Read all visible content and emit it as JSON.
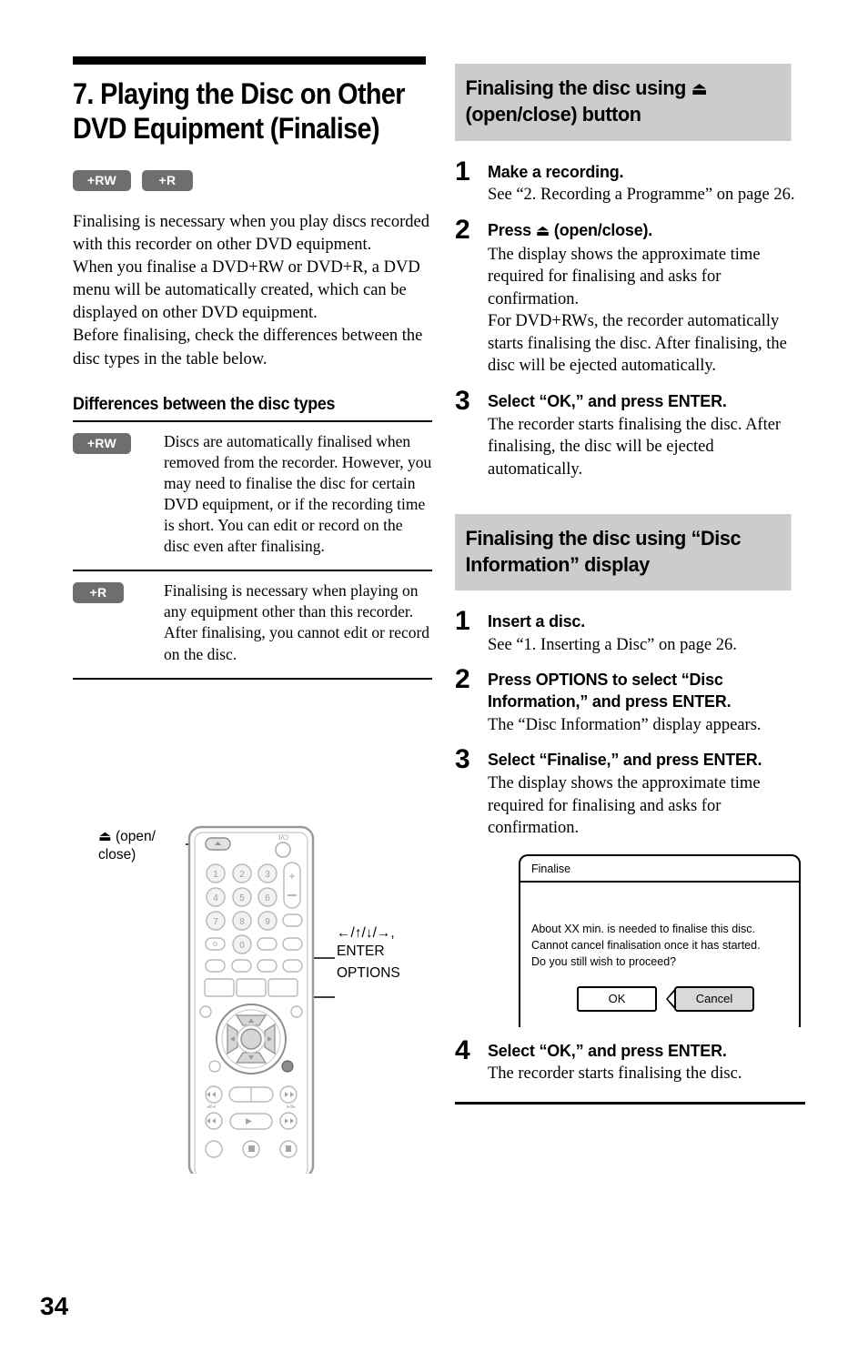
{
  "page": {
    "number": "34"
  },
  "chapter": {
    "title": "7. Playing the Disc on Other DVD Equipment (Finalise)",
    "badges": [
      {
        "label": "+RW"
      },
      {
        "label": "+R"
      }
    ],
    "intro": [
      "Finalising is necessary when you play discs recorded with this recorder on other DVD equipment.",
      "When you finalise a DVD+RW or DVD+R, a DVD menu will be automatically created, which can be displayed on other DVD equipment.",
      "Before finalising, check the differences between the disc types in the table below."
    ]
  },
  "disc_table": {
    "heading": "Differences between the disc types",
    "rows": [
      {
        "badge": "+RW",
        "description": "Discs are automatically finalised when removed from the recorder. However, you may need to finalise the disc for certain DVD equipment, or if the recording time is short. You can edit or record on the disc even after finalising."
      },
      {
        "badge": "+R",
        "description": "Finalising is necessary when playing on any equipment other than this recorder. After finalising, you cannot edit or record on the disc."
      }
    ]
  },
  "remote": {
    "callouts": [
      {
        "id": "eject",
        "line1": "⏏ (open/",
        "line2": "close)"
      },
      {
        "id": "dpad",
        "line1": "←/↑/↓/→,",
        "line2": "ENTER"
      },
      {
        "id": "options",
        "line1": "OPTIONS"
      }
    ],
    "keypad_digits": [
      "1",
      "2",
      "3",
      "4",
      "5",
      "6",
      "7",
      "8",
      "9",
      "0"
    ],
    "volume_plus": "+",
    "volume_minus": "−",
    "power_label": "I/⏻"
  },
  "sections": [
    {
      "heading_pre": "Finalising the disc using ",
      "heading_icon": "⏏",
      "heading_post": " (open/close) button",
      "steps": [
        {
          "num": "1",
          "title": "Make a recording.",
          "desc": "See “2. Recording a Programme” on page 26."
        },
        {
          "num": "2",
          "title_pre": "Press ",
          "title_icon": "⏏",
          "title_post": " (open/close).",
          "title": "Press ⏏ (open/close).",
          "desc": "The display shows the approximate time required for finalising and asks for confirmation.\nFor DVD+RWs, the recorder automatically starts finalising the disc. After finalising, the disc will be ejected automatically."
        },
        {
          "num": "3",
          "title": "Select “OK,” and press ENTER.",
          "desc": "The recorder starts finalising the disc. After finalising, the disc will be ejected automatically."
        }
      ]
    },
    {
      "heading": "Finalising the disc using “Disc Information” display",
      "steps": [
        {
          "num": "1",
          "title": "Insert a disc.",
          "desc": "See “1. Inserting a Disc” on page 26."
        },
        {
          "num": "2",
          "title": "Press OPTIONS to select “Disc Information,” and press ENTER.",
          "desc": "The “Disc Information” display appears."
        },
        {
          "num": "3",
          "title": "Select “Finalise,” and press ENTER.",
          "desc": "The display shows the approximate time required for finalising and asks for confirmation."
        },
        {
          "num": "4",
          "title": "Select “OK,” and press ENTER.",
          "desc": "The recorder starts finalising the disc."
        }
      ]
    }
  ],
  "osd_dialog": {
    "title": "Finalise",
    "message_line1": "About XX min. is needed to finalise this disc.",
    "message_line2": "Cannot cancel finalisation once it has started.",
    "message_line3": "Do you still wish to proceed?",
    "ok_label": "OK",
    "cancel_label": "Cancel"
  },
  "colors": {
    "badge_gray": "#6e6e6e",
    "heading_gray": "#cccccc",
    "selected_button_gray": "#d9d9d9"
  }
}
